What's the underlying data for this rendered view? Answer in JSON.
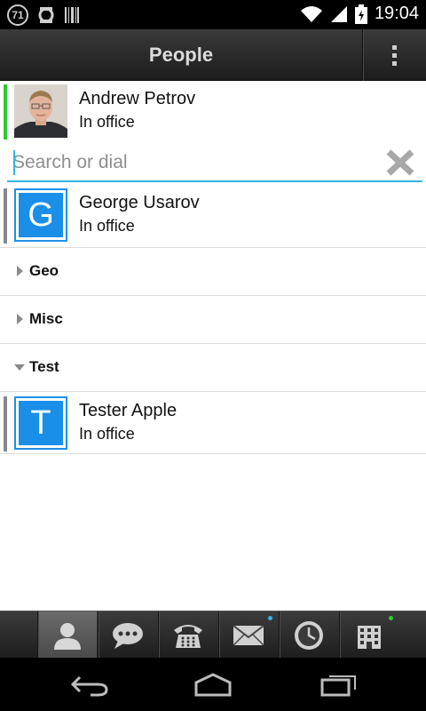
{
  "status_bar": {
    "notification_count": "71",
    "time": "19:04",
    "icons": [
      "notification-count-icon",
      "sync-icon",
      "barcode-icon",
      "wifi-icon",
      "signal-icon",
      "battery-icon"
    ]
  },
  "action_bar": {
    "title": "People",
    "overflow_icon": "overflow-menu-icon"
  },
  "self_contact": {
    "name": "Andrew Petrov",
    "status": "In office",
    "stripe_color": "#2ecc2e"
  },
  "search": {
    "placeholder": "Search or dial",
    "value": "",
    "clear_icon": "clear-icon",
    "accent": "#33b5e5"
  },
  "contacts": [
    {
      "initial": "G",
      "name": "George Usarov",
      "status": "In office"
    }
  ],
  "groups": [
    {
      "label": "Geo",
      "expanded": false
    },
    {
      "label": "Misc",
      "expanded": false
    },
    {
      "label": "Test",
      "expanded": true,
      "contacts": [
        {
          "initial": "T",
          "name": "Tester Apple",
          "status": "In office"
        }
      ]
    }
  ],
  "tabs": [
    {
      "name": "people",
      "icon": "person-icon",
      "active": true
    },
    {
      "name": "chat",
      "icon": "chat-bubble-icon",
      "active": false
    },
    {
      "name": "phone",
      "icon": "phone-icon",
      "active": false
    },
    {
      "name": "mail",
      "icon": "envelope-icon",
      "active": false,
      "dot_color": "#33b5e5"
    },
    {
      "name": "history",
      "icon": "clock-icon",
      "active": false
    },
    {
      "name": "directory",
      "icon": "building-icon",
      "active": false,
      "dot_color": "#2ecc2e"
    }
  ],
  "nav": [
    "back-icon",
    "home-icon",
    "recents-icon"
  ],
  "colors": {
    "brand_blue": "#1a8fe8",
    "presence_stripe": "#888888"
  }
}
